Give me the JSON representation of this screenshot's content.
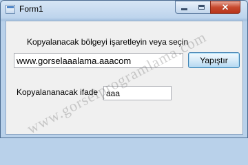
{
  "window": {
    "title": "Form1",
    "minimize_icon": "minimize-icon",
    "maximize_icon": "maximize-icon",
    "close_icon": "close-icon",
    "close_color": "#c84a2f"
  },
  "form": {
    "instruction_label": "Kopyalanacak bölgeyi işaretleyin veya seçin",
    "source_value": "www.gorselaaalama.aaacom",
    "paste_button": "Yapıştır",
    "copy_label": "Kopyalananacak ifade",
    "copied_value": "aaa"
  },
  "watermark": {
    "text": "www.gorselprogramlama.com"
  }
}
